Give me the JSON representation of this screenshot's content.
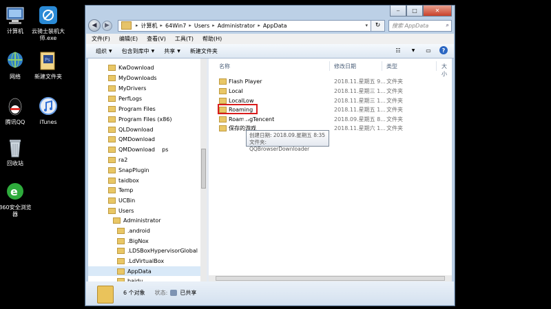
{
  "desktop": {
    "icons": [
      {
        "label": "计算机",
        "icon": "computer-icon"
      },
      {
        "label": "云骑士装机大师.exe",
        "icon": "app-icon"
      },
      {
        "label": "网络",
        "icon": "network-icon"
      },
      {
        "label": "新建文件夹",
        "icon": "folder-icon"
      },
      {
        "label": "腾讯QQ",
        "icon": "qq-icon"
      },
      {
        "label": "iTunes",
        "icon": "itunes-icon"
      },
      {
        "label": "回收站",
        "icon": "recycle-bin-icon"
      },
      {
        "label": "360安全浏览器",
        "icon": "browser-icon"
      }
    ]
  },
  "window": {
    "breadcrumb": [
      "计算机",
      "64Win7",
      "Users",
      "Administrator",
      "AppData"
    ],
    "search_placeholder": "搜索 AppData",
    "menu": [
      "文件(F)",
      "编辑(E)",
      "查看(V)",
      "工具(T)",
      "帮助(H)"
    ],
    "toolbar": [
      "组织",
      "包含到库中",
      "共享",
      "新建文件夹"
    ],
    "nav_items": [
      {
        "label": "KwDownload",
        "indent": 0
      },
      {
        "label": "MyDownloads",
        "indent": 0
      },
      {
        "label": "MyDrivers",
        "indent": 0
      },
      {
        "label": "PerfLogs",
        "indent": 0
      },
      {
        "label": "Program Files",
        "indent": 0
      },
      {
        "label": "Program Files (x86)",
        "indent": 0
      },
      {
        "label": "QLDownload",
        "indent": 0
      },
      {
        "label": "QMDownload",
        "indent": 0
      },
      {
        "label": "QMDownload    ps",
        "indent": 0
      },
      {
        "label": "ra2",
        "indent": 0
      },
      {
        "label": "SnapPlugin",
        "indent": 0
      },
      {
        "label": "taidbox",
        "indent": 0
      },
      {
        "label": "Temp",
        "indent": 0
      },
      {
        "label": "UCBin",
        "indent": 0
      },
      {
        "label": "Users",
        "indent": 0
      },
      {
        "label": "Administrator",
        "indent": 1
      },
      {
        "label": ".android",
        "indent": 2
      },
      {
        "label": ".BigNox",
        "indent": 2
      },
      {
        "label": ".LDSBoxHypervisorGlobal",
        "indent": 2
      },
      {
        "label": ".LdVirtualBox",
        "indent": 2
      },
      {
        "label": "AppData",
        "indent": 2,
        "selected": true
      },
      {
        "label": "baidu",
        "indent": 2
      }
    ],
    "columns": [
      "名称",
      "修改日期",
      "类型",
      "大小"
    ],
    "files": [
      {
        "name": "Flash Player",
        "date": "2018.11.星期五 9...",
        "type": "文件夹"
      },
      {
        "name": "Local",
        "date": "2018.11.星期三 1...",
        "type": "文件夹"
      },
      {
        "name": "LocalLow",
        "date": "2018.11.星期三 1...",
        "type": "文件夹"
      },
      {
        "name": "Roaming",
        "date": "2018.11.星期五 1...",
        "type": "文件夹"
      },
      {
        "name": "RoamingTencent",
        "date": "2018.09.星期五 8...",
        "type": "文件夹"
      },
      {
        "name": "保存的游戏",
        "date": "2018.11.星期六 1...",
        "type": "文件夹"
      }
    ],
    "tooltip": {
      "line1": "创建日期: 2018.09.星期五 8:35",
      "line2": "文件夹: QQBrowserDownloader"
    },
    "status": {
      "count": "6 个对象",
      "state_label": "状态:",
      "state_value": "已共享"
    }
  }
}
